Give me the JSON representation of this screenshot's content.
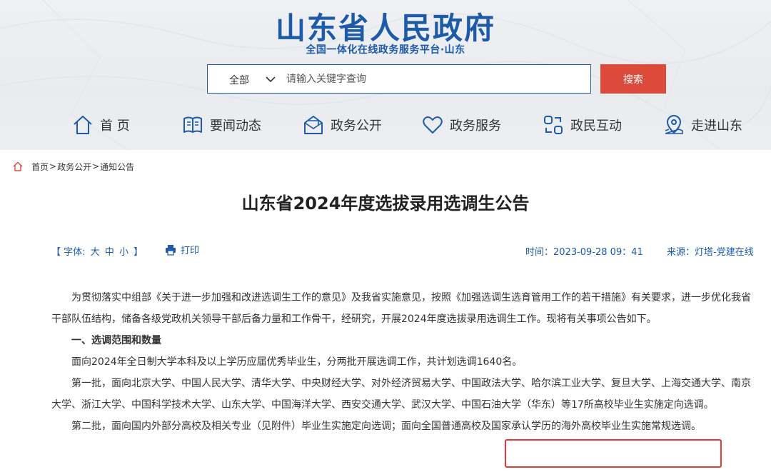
{
  "header": {
    "site_title": "山东省人民政府",
    "site_subtitle": "全国一体化在线政务服务平台·山东",
    "brand_color": "#1d5aa8",
    "search": {
      "scope": "全部",
      "placeholder": "请输入关键字查询",
      "button_label": "搜索",
      "button_color": "#dc4a3c"
    },
    "nav": [
      {
        "label": "首 页",
        "icon": "home-icon"
      },
      {
        "label": "要闻动态",
        "icon": "book-icon"
      },
      {
        "label": "政务公开",
        "icon": "envelope-icon"
      },
      {
        "label": "政务服务",
        "icon": "heart-icon"
      },
      {
        "label": "政民互动",
        "icon": "interact-icon"
      },
      {
        "label": "走进山东",
        "icon": "map-pin-icon"
      }
    ]
  },
  "breadcrumb": {
    "icon": "home-icon",
    "items": [
      "首页",
      "政务公开",
      "通知公告"
    ],
    "separator": ">"
  },
  "article": {
    "title": "山东省2024年度选拔录用选调生公告",
    "font_control": {
      "prefix": "【 字体:",
      "large": "大",
      "medium": "中",
      "small": "小",
      "suffix": "】"
    },
    "print_label": "打印",
    "time": "时间：2023-09-28 09：41",
    "source": "来源：灯塔-党建在线",
    "paragraphs": [
      "为贯彻落实中组部《关于进一步加强和改进选调生工作的意见》及我省实施意见，按照《加强选调生选育管用工作的若干措施》有关要求，进一步优化我省干部队伍结构，储备各级党政机关领导干部后备力量和工作骨干，经研究，开展2024年度选拔录用选调生工作。现将有关事项公告如下。",
      "一、选调范围和数量",
      "面向2024年全日制大学本科及以上学历应届优秀毕业生，分两批开展选调工作，共计划选调1640名。",
      "第一批，面向北京大学、中国人民大学、清华大学、中央财经大学、对外经济贸易大学、中国政法大学、哈尔滨工业大学、复旦大学、上海交通大学、南京大学、浙江大学、中国科学技术大学、山东大学、中国海洋大学、西安交通大学、武汉大学、中国石油大学（华东）等17所高校毕业生实施定向选调。",
      "第二批，面向国内外部分高校及相关专业（见附件）毕业生实施定向选调；面向全国普通高校及国家承认学历的海外高校毕业生实施常规选调。"
    ],
    "highlight_color": "#e53935"
  }
}
